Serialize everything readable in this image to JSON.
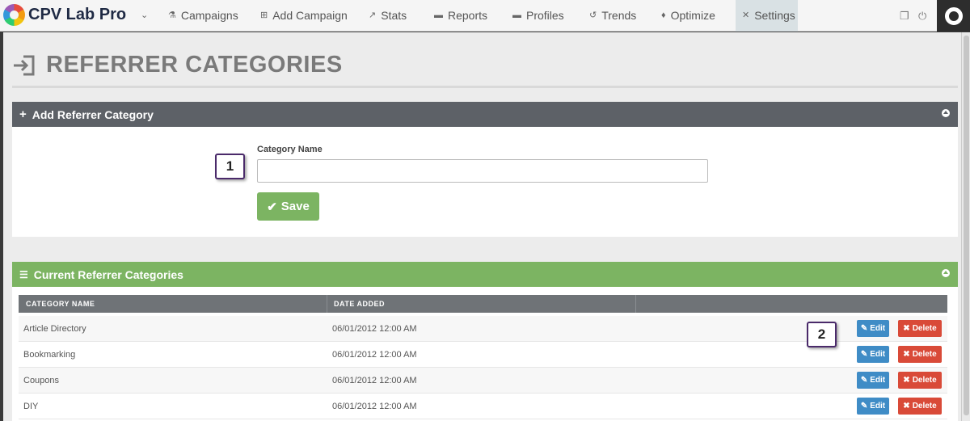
{
  "app": {
    "name": "CPV Lab Pro"
  },
  "nav": {
    "items": [
      {
        "label": "Campaigns",
        "icon": "flask-icon",
        "glyph": "⚗"
      },
      {
        "label": "Add Campaign",
        "icon": "plus-square-icon",
        "glyph": "⊞"
      },
      {
        "label": "Stats",
        "icon": "line-chart-icon",
        "glyph": "↗"
      },
      {
        "label": "Reports",
        "icon": "briefcase-icon",
        "glyph": "▬"
      },
      {
        "label": "Profiles",
        "icon": "archive-icon",
        "glyph": "▬"
      },
      {
        "label": "Trends",
        "icon": "history-icon",
        "glyph": "↺"
      },
      {
        "label": "Optimize",
        "icon": "lightbulb-icon",
        "glyph": "♦"
      },
      {
        "label": "Settings",
        "icon": "tools-icon",
        "glyph": "✕",
        "active": true
      }
    ]
  },
  "page": {
    "title": "REFERRER CATEGORIES"
  },
  "add_panel": {
    "title": "Add Referrer Category",
    "field_label": "Category Name",
    "field_value": "",
    "save_label": "Save"
  },
  "list_panel": {
    "title": "Current Referrer Categories",
    "columns": [
      "CATEGORY NAME",
      "DATE ADDED"
    ],
    "rows": [
      {
        "name": "Article Directory",
        "date": "06/01/2012 12:00 AM"
      },
      {
        "name": "Bookmarking",
        "date": "06/01/2012 12:00 AM"
      },
      {
        "name": "Coupons",
        "date": "06/01/2012 12:00 AM"
      },
      {
        "name": "DIY",
        "date": "06/01/2012 12:00 AM"
      }
    ],
    "edit_label": "Edit",
    "delete_label": "Delete"
  },
  "callouts": [
    "1",
    "2"
  ],
  "colors": {
    "green": "#7cb462",
    "dark_header": "#5d6167",
    "edit": "#3f8cc6",
    "delete": "#d94a38"
  }
}
